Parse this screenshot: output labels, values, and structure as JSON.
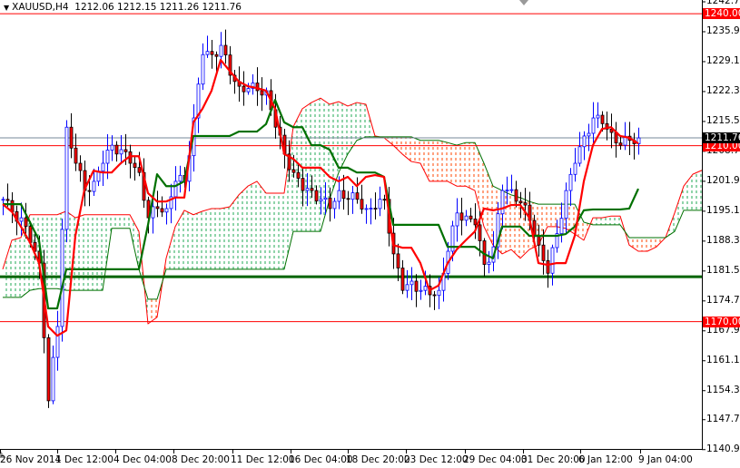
{
  "header": {
    "symbol": "XAUUSD,H4",
    "ohlc": "1212.06 1212.15 1211.26 1211.76",
    "menu_icon": "triangle-down-icon"
  },
  "colors": {
    "bull": "#0000ff",
    "bear": "#ff0000",
    "tenkan": "#ff0000",
    "kijun": "#007000",
    "cloud_up": "#22aa55",
    "cloud_down": "#ff4400",
    "level_red": "#ff0000",
    "level_green": "#006400",
    "bid_line": "#778899"
  },
  "chart_data": {
    "type": "candlestick",
    "title": "XAUUSD,H4",
    "ylim": [
      1140.9,
      1242.7
    ],
    "y_ticks": [
      "1242.70",
      "1235.90",
      "1229.10",
      "1222.30",
      "1215.50",
      "1208.70",
      "1201.90",
      "1195.10",
      "1188.30",
      "1181.50",
      "1174.70",
      "1167.90",
      "1161.10",
      "1154.30",
      "1147.70",
      "1140.90"
    ],
    "x_ticks": [
      "26 Nov 2014",
      "1 Dec 12:00",
      "4 Dec 04:00",
      "8 Dec 20:00",
      "11 Dec 12:00",
      "16 Dec 04:00",
      "18 Dec 20:00",
      "23 Dec 12:00",
      "29 Dec 04:00",
      "31 Dec 20:00",
      "6 Jan 12:00",
      "9 Jan 04:00"
    ],
    "closes": [
      1197.8,
      1195,
      1193.6,
      1188,
      1183.3,
      1152,
      1168.9,
      1214.2,
      1206,
      1199.8,
      1201.9,
      1206,
      1210.1,
      1209.1,
      1206,
      1203.9,
      1193.6,
      1195.7,
      1195.7,
      1201.9,
      1201.9,
      1216.3,
      1230.7,
      1230.7,
      1232.8,
      1226,
      1223.5,
      1223,
      1222.5,
      1222.5,
      1214.2,
      1208.1,
      1203.9,
      1199.8,
      1199.8,
      1197.8,
      1195.7,
      1199.8,
      1197.8,
      1197.8,
      1195.7,
      1195.7,
      1197.8,
      1185.4,
      1177.1,
      1179.2,
      1177.1,
      1176.1,
      1177.1,
      1186,
      1194.7,
      1194,
      1192,
      1183,
      1187,
      1199.8,
      1200,
      1197,
      1193,
      1187.4,
      1181,
      1190,
      1199.8,
      1206,
      1212.2,
      1216.3,
      1215,
      1213,
      1210.1,
      1211.2,
      1211.76
    ],
    "tenkan": [
      1196.7,
      1195,
      1191.6,
      1188,
      1183.3,
      1168.9,
      1166.8,
      1168,
      1189.5,
      1200,
      1204.3,
      1203.9,
      1203.9,
      1206,
      1207.6,
      1207.6,
      1199.2,
      1197.3,
      1197.3,
      1198.2,
      1198.2,
      1215.3,
      1218.4,
      1222.5,
      1229.5,
      1227,
      1224.6,
      1223.5,
      1223.1,
      1222.5,
      1218.4,
      1208.1,
      1207,
      1205,
      1205,
      1205,
      1202.9,
      1201.9,
      1202.9,
      1200.8,
      1202.9,
      1203.3,
      1202.9,
      1187.4,
      1186.8,
      1186.8,
      1183.3,
      1177.1,
      1178.2,
      1183.3,
      1186.4,
      1188.5,
      1190.5,
      1195.7,
      1195.3,
      1195.7,
      1196.5,
      1196.5,
      1193.6,
      1183.3,
      1182.9,
      1183.3,
      1183.3,
      1189.5,
      1201.9,
      1210.1,
      1213.8,
      1214.2,
      1212.2,
      1211.8,
      1210.5
    ],
    "kijun": [
      1196.7,
      1196.7,
      1196.7,
      1192.6,
      1188.5,
      1173,
      1173,
      1181.9,
      1181.9,
      1181.9,
      1181.9,
      1181.9,
      1181.9,
      1181.9,
      1181.9,
      1181.9,
      1192,
      1203.5,
      1200.8,
      1200.8,
      1201.9,
      1212.2,
      1212.2,
      1212.2,
      1212.2,
      1212.2,
      1213.2,
      1213.2,
      1213.2,
      1214.9,
      1220.4,
      1215.3,
      1214.2,
      1214.2,
      1210.1,
      1210.1,
      1209.1,
      1205,
      1205,
      1203.9,
      1203.9,
      1203.9,
      1202.9,
      1192,
      1192,
      1192,
      1192,
      1192,
      1192,
      1187,
      1187,
      1187,
      1187,
      1185.4,
      1184.4,
      1191.6,
      1191.6,
      1191.6,
      1189.5,
      1189.5,
      1189.5,
      1189.5,
      1189.9,
      1191.6,
      1195.3,
      1195.5,
      1195.5,
      1195.5,
      1195.5,
      1195.7,
      1200.2
    ],
    "span_a": [
      1181.9,
      1188.5,
      1189.1,
      1194.3,
      1194.3,
      1194.3,
      1194.3,
      1195.1,
      1193.6,
      1194.3,
      1194.3,
      1194.3,
      1194.3,
      1194.3,
      1194.3,
      1190.5,
      1169.5,
      1171.0,
      1184.4,
      1191.6,
      1195.3,
      1194.3,
      1195.1,
      1195.7,
      1195.7,
      1196.1,
      1198.8,
      1200.8,
      1201.9,
      1199.2,
      1199.2,
      1199.2,
      1214.3,
      1218.4,
      1219.8,
      1220.8,
      1219.4,
      1220.0,
      1219.0,
      1219.8,
      1219.4,
      1212.2,
      1211.8,
      1210.1,
      1208.1,
      1206.4,
      1206.0,
      1201.9,
      1201.9,
      1201.9,
      1200.8,
      1200.8,
      1199.8,
      1191.6,
      1187.4,
      1185.4,
      1186.4,
      1184.4,
      1186.4,
      1187.4,
      1191.6,
      1191.6,
      1191.2,
      1189.9,
      1188.5,
      1193.6,
      1193.6,
      1194.0,
      1194.0,
      1187.4,
      1186.0,
      1186.0,
      1187.0,
      1189.1,
      1194.7,
      1200.8,
      1203.5,
      1204.4
    ],
    "span_b": [
      1175.5,
      1175.5,
      1175.5,
      1177.1,
      1177.5,
      1177.5,
      1177.5,
      1177.1,
      1177.1,
      1177.1,
      1177.1,
      1177.1,
      1191.2,
      1191.2,
      1191.2,
      1181.9,
      1175.1,
      1175.1,
      1181.9,
      1181.9,
      1181.9,
      1181.9,
      1181.9,
      1181.9,
      1181.9,
      1181.9,
      1181.9,
      1181.9,
      1181.9,
      1181.9,
      1181.9,
      1181.9,
      1190.5,
      1190.5,
      1190.5,
      1190.5,
      1197.8,
      1203.9,
      1208.1,
      1211.2,
      1212.0,
      1212.0,
      1212.0,
      1212.0,
      1212.0,
      1212.0,
      1211.2,
      1211.2,
      1211.2,
      1210.7,
      1210.1,
      1210.7,
      1210.7,
      1206.0,
      1200.8,
      1199.8,
      1198.8,
      1198.2,
      1197.3,
      1196.7,
      1196.7,
      1196.7,
      1196.7,
      1196.7,
      1192.6,
      1192.0,
      1192.0,
      1192.0,
      1192.0,
      1189.1,
      1189.1,
      1189.1,
      1189.1,
      1189.1,
      1190.5,
      1195.3,
      1195.3,
      1195.3
    ],
    "levels": [
      {
        "value": 1240.0,
        "label": "1240.00",
        "color": "#ff0000"
      },
      {
        "value": 1210.0,
        "label": "1210.00",
        "color": "#ff0000"
      },
      {
        "value": 1170.0,
        "label": "1170.00",
        "color": "#ff0000"
      },
      {
        "value": 1180.2,
        "label": "",
        "color": "#006400"
      }
    ],
    "current_price": {
      "value": 1211.76,
      "label": "1211.76"
    }
  }
}
